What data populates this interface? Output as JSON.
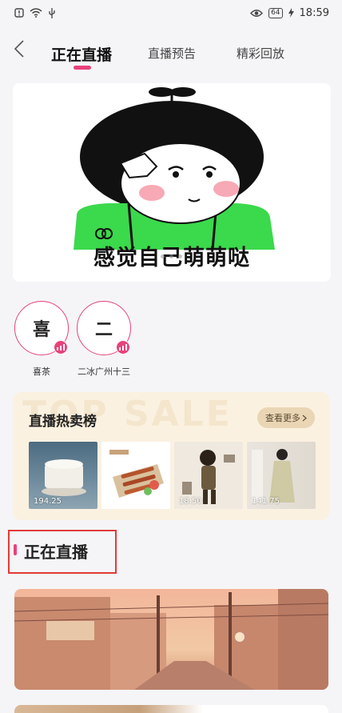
{
  "status_bar": {
    "time": "18:59",
    "battery": "64"
  },
  "tabs": [
    {
      "label": "正在直播"
    },
    {
      "label": "直播预告"
    },
    {
      "label": "精彩回放"
    }
  ],
  "banner": {
    "caption": "感觉自己萌萌哒"
  },
  "anchors": [
    {
      "avatar_char": "喜",
      "name": "喜茶"
    },
    {
      "avatar_char": "二",
      "name": "二冰广州十三"
    }
  ],
  "hot_sales": {
    "watermark": "TOP SALE",
    "title": "直播热卖榜",
    "see_more": "查看更多",
    "products": [
      {
        "price": "194.25"
      },
      {
        "price": ""
      },
      {
        "price": "18.50"
      },
      {
        "price": "141.75"
      }
    ]
  },
  "live_section": {
    "title": "正在直播"
  },
  "colors": {
    "accent": "#e8427a",
    "highlight_box": "#e23a3a",
    "hot_bg": "#fbf1e1"
  }
}
